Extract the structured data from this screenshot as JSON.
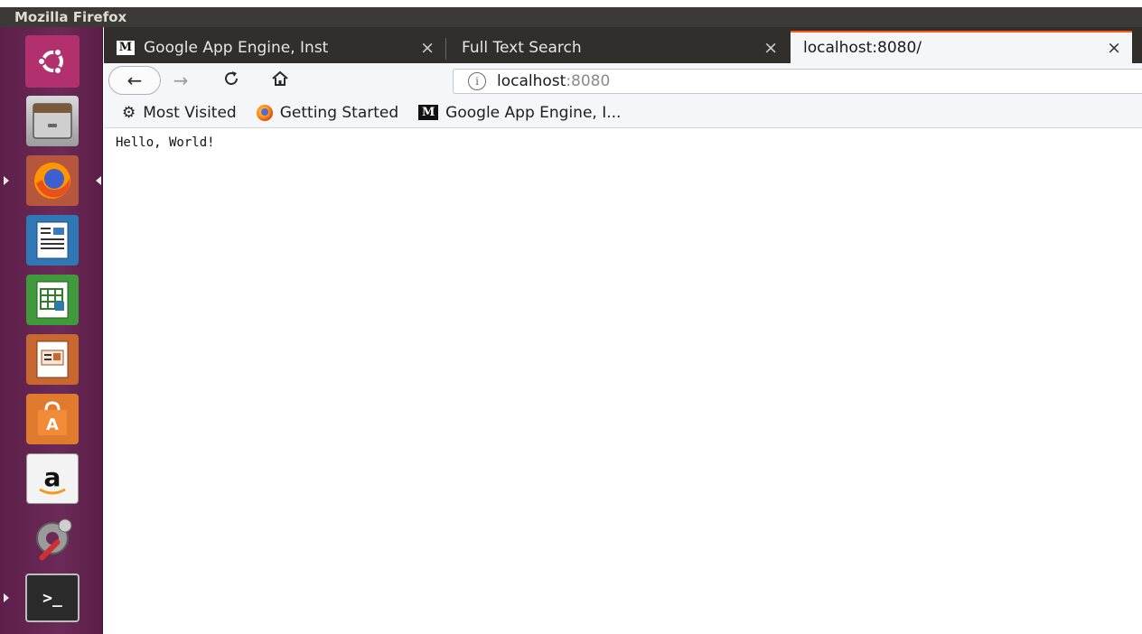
{
  "window": {
    "title": "Mozilla Firefox"
  },
  "tabs": [
    {
      "label": "Google App Engine, Inst",
      "favicon": "M",
      "close": "×"
    },
    {
      "label": "Full Text Search",
      "close": "×"
    },
    {
      "label": "localhost:8080/",
      "close": "×",
      "active": true
    }
  ],
  "nav": {
    "back_glyph": "←",
    "forward_glyph": "→",
    "reload_glyph": "C",
    "home_glyph": "⌂",
    "info_glyph": "i",
    "url_host": "localhost",
    "url_port": ":8080"
  },
  "bookmarks": {
    "most_visited": "Most Visited",
    "getting_started": "Getting Started",
    "gae": "Google App Engine, I...",
    "gae_favicon": "M",
    "gear_glyph": "⚙"
  },
  "page": {
    "body_text": "Hello, World!"
  },
  "launcher": {
    "amazon_glyph": "a",
    "terminal_glyph": ">_",
    "appstore_glyph": "A"
  },
  "colors": {
    "launcher_bg": "#6b2a57",
    "tabbar_bg": "#302f2c",
    "active_tab_accent": "#ff5a1c",
    "toolbar_bg": "#f5f6f7"
  }
}
